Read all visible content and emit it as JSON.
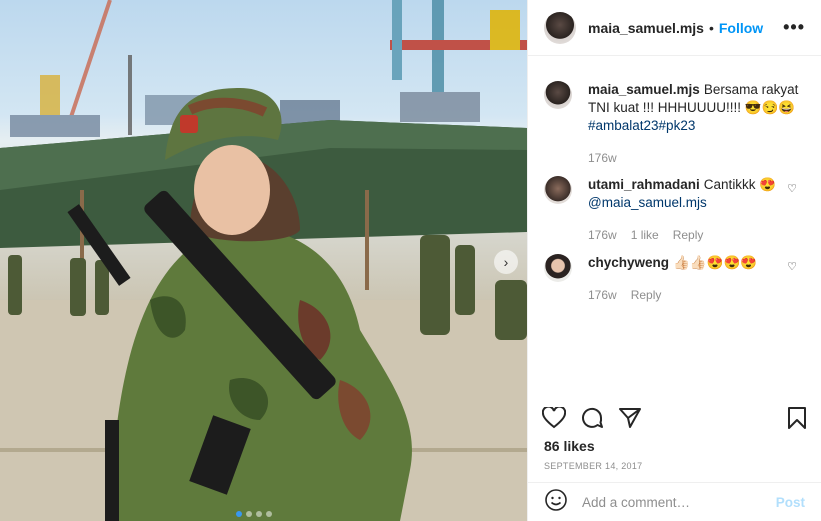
{
  "post": {
    "username": "maia_samuel.mjs",
    "separator": "•",
    "follow_label": "Follow",
    "more_label": "•••",
    "next_label": "›"
  },
  "caption": {
    "username": "maia_samuel.mjs",
    "text": "Bersama rakyat TNI kuat !!! HHHUUUU!!!! 😎😏😆",
    "hashtags": "#ambalat23#pk23",
    "time": "176w"
  },
  "comments": [
    {
      "username": "utami_rahmadani",
      "text": "Cantikkk 😍",
      "mention": "@maia_samuel.mjs",
      "time": "176w",
      "likes": "1 like",
      "reply": "Reply"
    },
    {
      "username": "chychyweng",
      "text": "👍🏻👍🏻😍😍😍",
      "time": "176w",
      "reply": "Reply"
    }
  ],
  "likes_text": "86 likes",
  "date_text": "SEPTEMBER 14, 2017",
  "add_comment": {
    "placeholder": "Add a comment…",
    "post_label": "Post"
  },
  "icons": [
    "like-heart-icon",
    "comment-icon",
    "share-icon",
    "save-bookmark-icon",
    "emoji-icon",
    "more-icon",
    "comment-heart-icon"
  ],
  "colors": {
    "follow": "#0095f6",
    "link": "#00376b",
    "muted": "#8e8e8e",
    "post_disabled": "#b2dffc"
  }
}
